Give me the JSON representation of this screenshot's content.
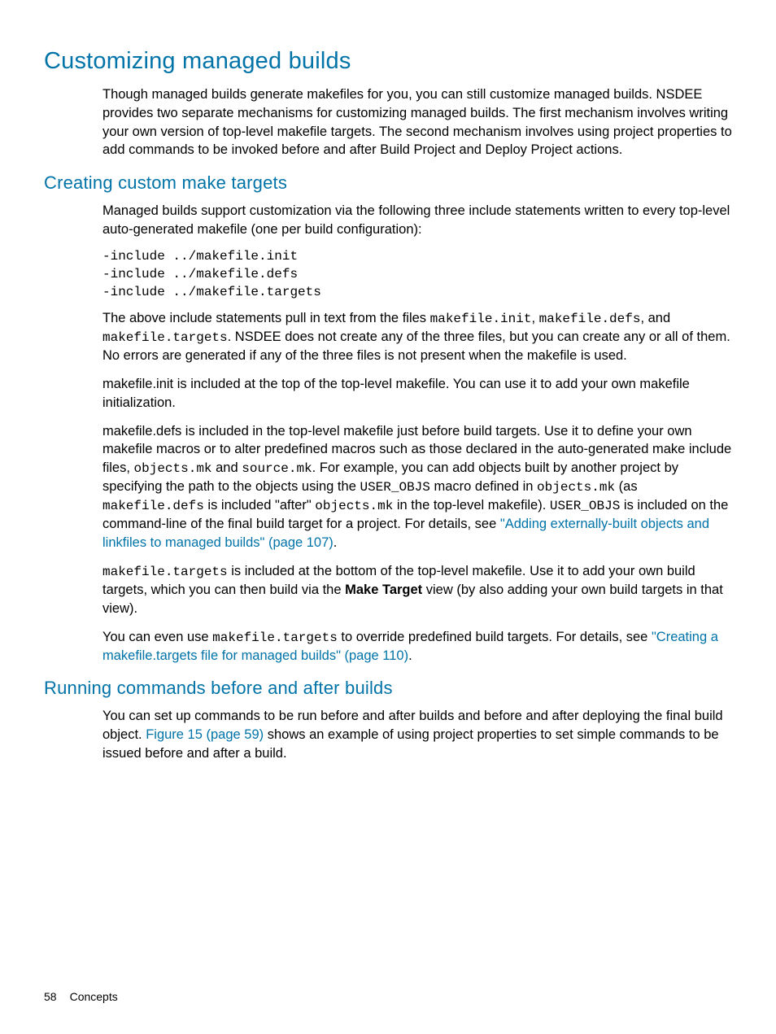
{
  "h1": "Customizing managed builds",
  "p1": "Though managed builds generate makefiles for you, you can still customize managed builds. NSDEE provides two separate mechanisms for customizing managed builds. The first mechanism involves writing your own version of top-level makefile targets. The second mechanism involves using project properties to add commands to be invoked before and after Build Project and Deploy Project actions.",
  "h2a": "Creating custom make targets",
  "p2": "Managed builds support customization via the following three include statements written to every top-level auto-generated makefile (one per build configuration):",
  "code1": "-include ../makefile.init\n-include ../makefile.defs\n-include ../makefile.targets",
  "p3_a": "The above include statements pull in text from the files ",
  "p3_c1": "makefile.init",
  "p3_b": ", ",
  "p3_c2": "makefile.defs",
  "p3_c": ", and ",
  "p3_c3": "makefile.targets",
  "p3_d": ". NSDEE does not create any of the three files, but you can create any or all of them. No errors are generated if any of the three files is not present when the makefile is used.",
  "p4": "makefile.init is included at the top of the top-level makefile. You can use it to add your own makefile initialization.",
  "p5_a": "makefile.defs is included in the top-level makefile just before build targets. Use it to define your own makefile macros or to alter predefined macros such as those declared in the auto-generated make include files, ",
  "p5_c1": "objects.mk",
  "p5_b": " and ",
  "p5_c2": "source.mk",
  "p5_c": ". For example, you can add objects built by another project by specifying the path to the objects using the ",
  "p5_c3": "USER_OBJS",
  "p5_d": " macro defined in ",
  "p5_c4": "objects.mk",
  "p5_e": " (as ",
  "p5_c5": " makefile.defs",
  "p5_f": " is included \"after\" ",
  "p5_c6": "objects.mk",
  "p5_g": " in the top-level makefile). ",
  "p5_c7": "USER_OBJS",
  "p5_h": " is included on the command-line of the final build target for a project. For details, see ",
  "p5_link": "\"Adding externally-built objects and linkfiles to managed builds\" (page 107)",
  "p5_i": ".",
  "p6_c1": "makefile.targets",
  "p6_a": " is included at the bottom of the top-level makefile. Use it to add your own build targets, which you can then build via the ",
  "p6_b1": "Make Target",
  "p6_b": " view (by also adding your own build targets in that view).",
  "p7_a": "You can even use ",
  "p7_c1": "makefile.targets",
  "p7_b": " to override predefined build targets. For details, see ",
  "p7_link": "\"Creating a makefile.targets file for managed builds\" (page 110)",
  "p7_c": ".",
  "h2b": "Running commands before and after builds",
  "p8_a": "You can set up commands to be run before and after builds and before and after deploying the final build object. ",
  "p8_link": "Figure 15 (page 59)",
  "p8_b": " shows an example of using project properties to set simple commands to be issued before and after a build.",
  "footer_page": "58",
  "footer_section": "Concepts"
}
